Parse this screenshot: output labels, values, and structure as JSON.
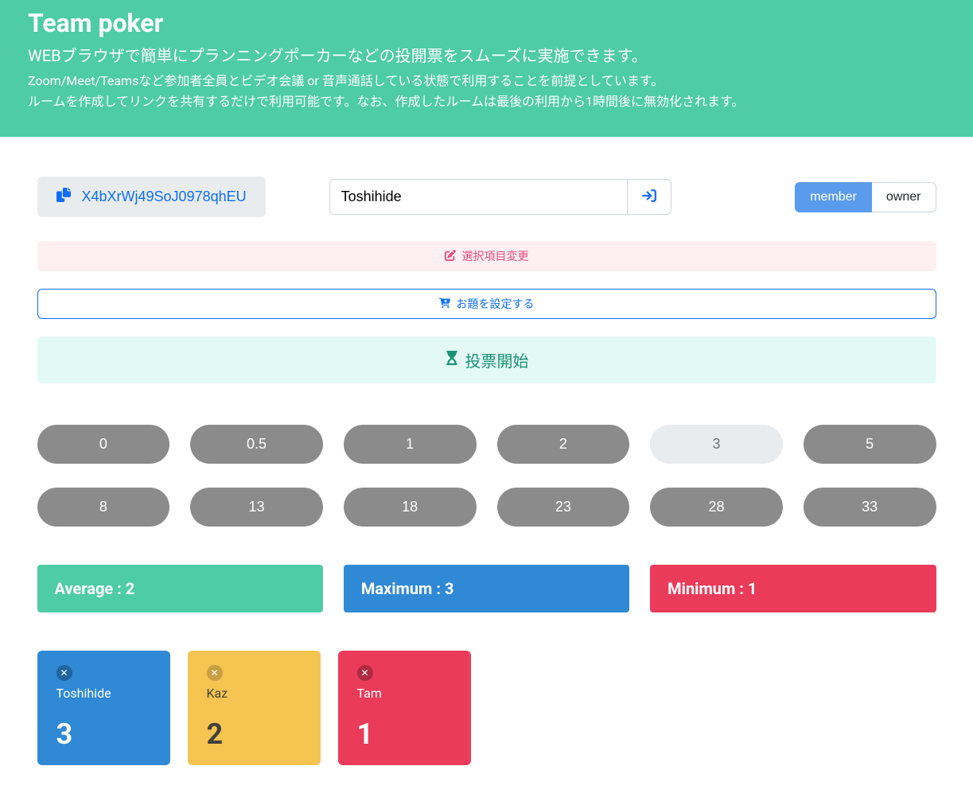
{
  "header": {
    "title": "Team poker",
    "subtitle": "WEBブラウザで簡単にプランニングポーカーなどの投開票をスムーズに実施できます。",
    "note1": "Zoom/Meet/Teamsなど参加者全員とビデオ会議 or 音声通話している状態で利用することを前提としています。",
    "note2": "ルームを作成してリンクを共有するだけで利用可能です。なお、作成したルームは最後の利用から1時間後に無効化されます。"
  },
  "room": {
    "id": "X4bXrWj49SoJ0978qhEU",
    "username": "Toshihide"
  },
  "toggle": {
    "member": "member",
    "owner": "owner"
  },
  "actions": {
    "change_options": "選択項目変更",
    "set_topic": "お題を設定する",
    "start_vote": "投票開始"
  },
  "vote_options": [
    "0",
    "0.5",
    "1",
    "2",
    "3",
    "5",
    "8",
    "13",
    "18",
    "23",
    "28",
    "33"
  ],
  "selected_index": 4,
  "stats": {
    "average_label": "Average :",
    "average_value": "2",
    "maximum_label": "Maximum :",
    "maximum_value": "3",
    "minimum_label": "Minimum :",
    "minimum_value": "1"
  },
  "players": [
    {
      "name": "Toshihide",
      "vote": "3",
      "color": "blue"
    },
    {
      "name": "Kaz",
      "vote": "2",
      "color": "yellow"
    },
    {
      "name": "Tam",
      "vote": "1",
      "color": "red"
    }
  ]
}
